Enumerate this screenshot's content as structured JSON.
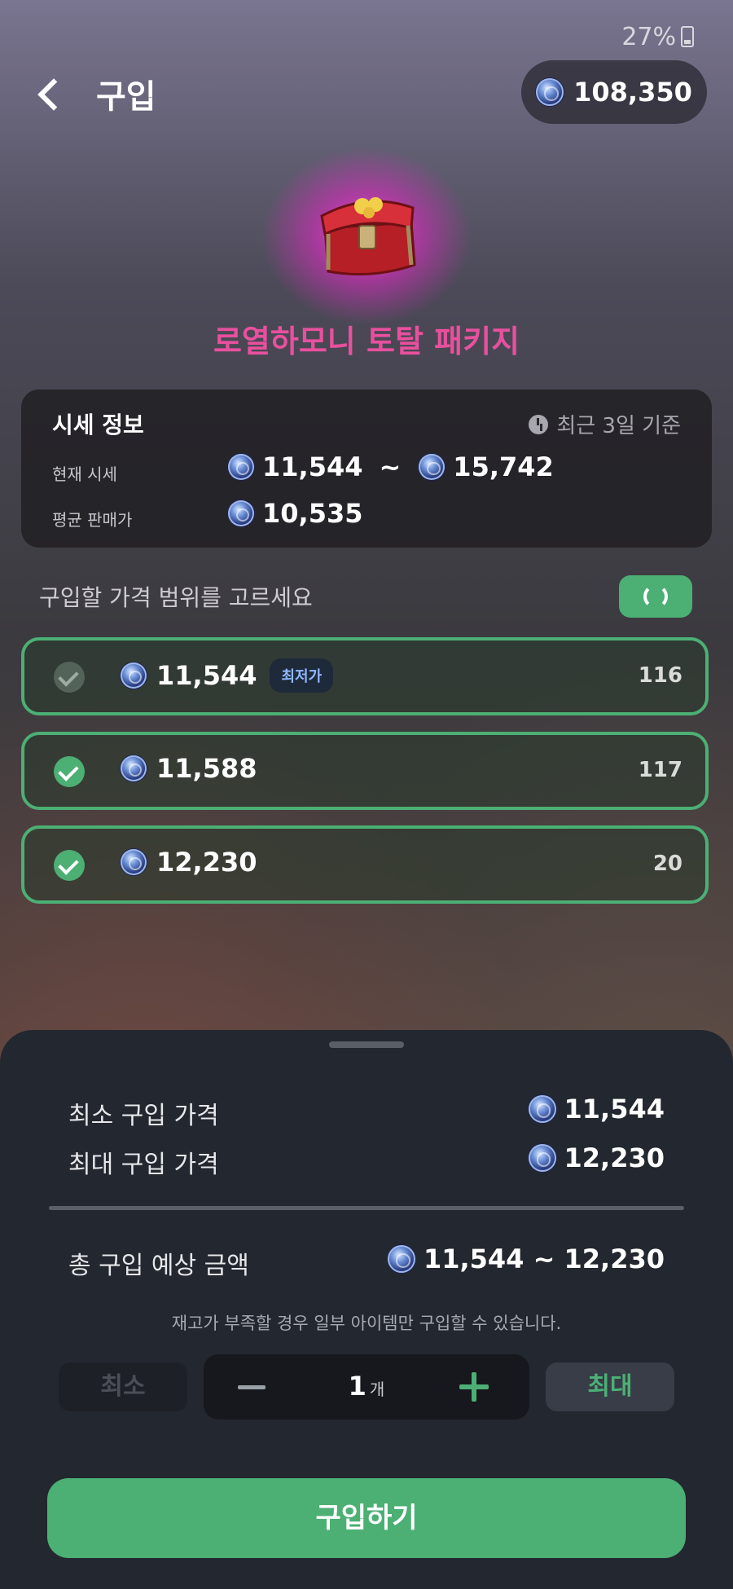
{
  "status": {
    "battery": "27%"
  },
  "header": {
    "title": "구입",
    "balance": "108,350"
  },
  "item": {
    "name": "로열하모니 토탈 패키지"
  },
  "market_info": {
    "title": "시세 정보",
    "period": "최근 3일 기준",
    "current_label": "현재 시세",
    "current_min": "11,544",
    "range_sep": "~",
    "current_max": "15,742",
    "average_label": "평균 판매가",
    "average": "10,535"
  },
  "price_range": {
    "prompt": "구입할 가격 범위를 고르세요",
    "rows": [
      {
        "price": "11,544",
        "badge": "최저가",
        "qty": "116",
        "checked": false
      },
      {
        "price": "11,588",
        "qty": "117",
        "checked": true
      },
      {
        "price": "12,230",
        "qty": "20",
        "checked": true
      }
    ]
  },
  "summary": {
    "min_label": "최소 구입 가격",
    "min_value": "11,544",
    "max_label": "최대 구입 가격",
    "max_value": "12,230",
    "total_label": "총 구입 예상 금액",
    "total_value": "11,544 ~ 12,230",
    "notice": "재고가 부족할 경우 일부 아이템만 구입할 수 있습니다.",
    "min_button": "최소",
    "quantity": "1",
    "quantity_unit": "개",
    "max_button": "최대",
    "buy_button": "구입하기"
  },
  "colors": {
    "accent": "#4caf74",
    "item_name": "#e8509e",
    "sheet": "#23272f"
  }
}
